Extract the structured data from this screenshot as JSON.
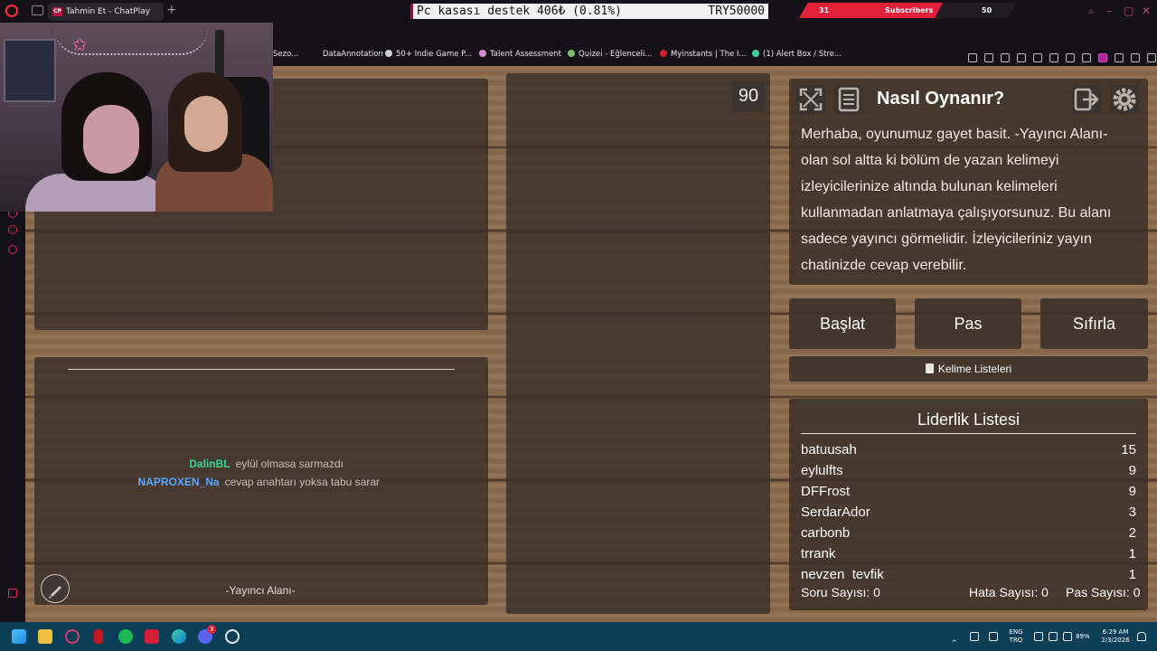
{
  "browser": {
    "tab_title": "Tahmin Et - ChatPlay",
    "tab_favicon": "CP",
    "new_tab": "+"
  },
  "stream_overlay": {
    "ticker_text": "Pc kasası destek 406₺ (0.81%)",
    "ticker_goal": "TRY50000",
    "subs_current": "31",
    "subs_label": "Subscribers",
    "subs_goal": "50"
  },
  "bookmarks": [
    {
      "label": "Sezo...",
      "icon": "",
      "icon_color": ""
    },
    {
      "label": "DataAnnotation",
      "icon": "",
      "icon_color": ""
    },
    {
      "label": "50+ Indie Game P...",
      "icon": "gear-icon",
      "icon_color": "#cfcfcf"
    },
    {
      "label": "Talent Assessment",
      "icon": "shield-icon",
      "icon_color": "#d88ad0"
    },
    {
      "label": "Quizei - Eğlenceli...",
      "icon": "leaf-icon",
      "icon_color": "#7fbf6a"
    },
    {
      "label": "Myinstants | The I...",
      "icon": "circle-icon",
      "icon_color": "#d0202a"
    },
    {
      "label": "(1) Alert Box / Stre...",
      "icon": "streamlabs-icon",
      "icon_color": "#3fd0a0"
    }
  ],
  "game": {
    "timer": "90",
    "chat": [
      {
        "user": "DalinBL",
        "message": "eylül olmasa sarmazdı",
        "color": "#36d39a"
      },
      {
        "user": "NAPROXEN_Na",
        "message": "cevap anahtarı yoksa tabu sarar",
        "color": "#5aa9ff"
      }
    ],
    "streamer_area_label": "-Yayıncı Alanı-",
    "info_title": "Nasıl Oynanır?",
    "info_text": "Merhaba, oyunumuz gayet basit. -Yayıncı Alanı- olan sol altta ki bölüm de yazan kelimeyi izleyicilerinize altında bulunan kelimeleri kullanmadan anlatmaya çalışıyorsunuz. Bu alanı sadece yayıncı görmelidir. İzleyicileriniz yayın chatinizde cevap verebilir.",
    "buttons": {
      "start": "Başlat",
      "pass": "Pas",
      "reset": "Sıfırla"
    },
    "word_lists_label": "Kelime Listeleri",
    "leaderboard_title": "Liderlik Listesi",
    "leaderboard": [
      {
        "name": "batuusah",
        "score": "15"
      },
      {
        "name": "eylulfts",
        "score": "9"
      },
      {
        "name": "DFFrost",
        "score": "9"
      },
      {
        "name": "SerdarAdor",
        "score": "3"
      },
      {
        "name": "carbonb",
        "score": "2"
      },
      {
        "name": "trrank",
        "score": "1"
      },
      {
        "name": "nevzen_tevfik",
        "score": "1"
      }
    ],
    "stats": {
      "questions": "Soru Sayısı: 0",
      "errors": "Hata Sayısı: 0",
      "passes": "Pas Sayısı: 0"
    }
  },
  "taskbar": {
    "lang_top": "ENG",
    "lang_bottom": "TRQ",
    "battery": "89%",
    "time": "6:29 AM",
    "date": "2/3/2026",
    "discord_badge": "3"
  },
  "colors": {
    "accent_red": "#e3203a",
    "wood": "#8a6a4c",
    "panel": "#3a3028",
    "taskbar": "#0b3f58"
  }
}
